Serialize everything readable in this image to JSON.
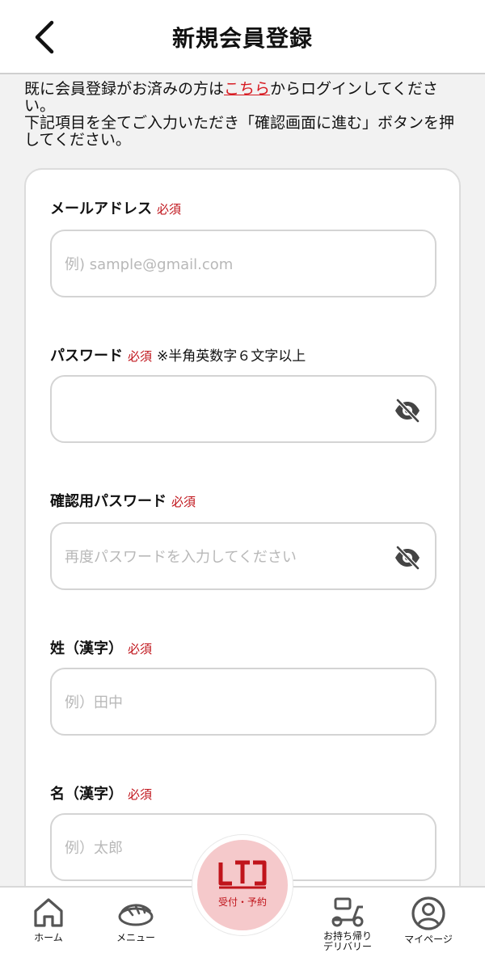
{
  "header": {
    "title": "新規会員登録",
    "back_icon": "chevron-left-icon"
  },
  "intro": {
    "line1_before": "既に会員登録がお済みの方は",
    "line1_link": "こちら",
    "line1_after": "からログインしてください。",
    "line2": "下記項目を全てご入力いただき「確認画面に進む」ボタンを押してください。"
  },
  "form": {
    "required_label": "必須",
    "email": {
      "label": "メールアドレス",
      "placeholder": "例) sample@gmail.com"
    },
    "password": {
      "label": "パスワード",
      "note": "※半角英数字６文字以上",
      "placeholder": ""
    },
    "password_confirm": {
      "label": "確認用パスワード",
      "placeholder": "再度パスワードを入力してください"
    },
    "last_name": {
      "label": "姓（漢字）",
      "placeholder": "例）田中"
    },
    "first_name": {
      "label": "名（漢字）",
      "placeholder": "例）太郎"
    }
  },
  "tabbar": {
    "home": "ホーム",
    "menu": "メニュー",
    "reserve": "受付・予約",
    "takeout_line1": "お持ち帰り",
    "takeout_line2": "デリバリー",
    "mypage": "マイページ"
  },
  "colors": {
    "accent": "#d71a21",
    "required": "#c0141b",
    "fab_bg": "#f5c9cb",
    "page_bg": "#f2f2f2"
  }
}
